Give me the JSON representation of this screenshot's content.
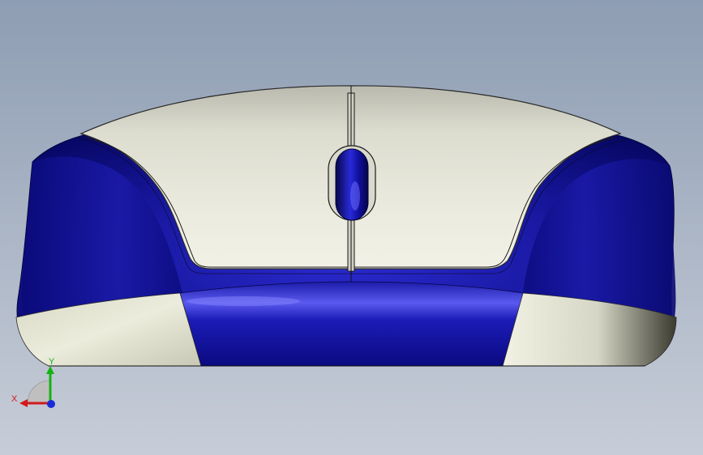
{
  "viewport": {
    "background_top": "#8e9db3",
    "background_bottom": "#c7cdd8"
  },
  "model": {
    "body_blue": "#16169a",
    "body_blue_dark": "#05055e",
    "shell_cream": "#e6e6d8",
    "shell_shadow": "#9a9a88",
    "edge_line": "#1b1b1b"
  },
  "triad": {
    "x_label": "X",
    "y_label": "Y",
    "x_color": "#d11a1a",
    "y_color": "#12b312",
    "z_color": "#1a2bd6",
    "x_icon": "x-axis-arrow-icon",
    "y_icon": "y-axis-arrow-icon",
    "z_icon": "z-axis-dot-icon"
  }
}
